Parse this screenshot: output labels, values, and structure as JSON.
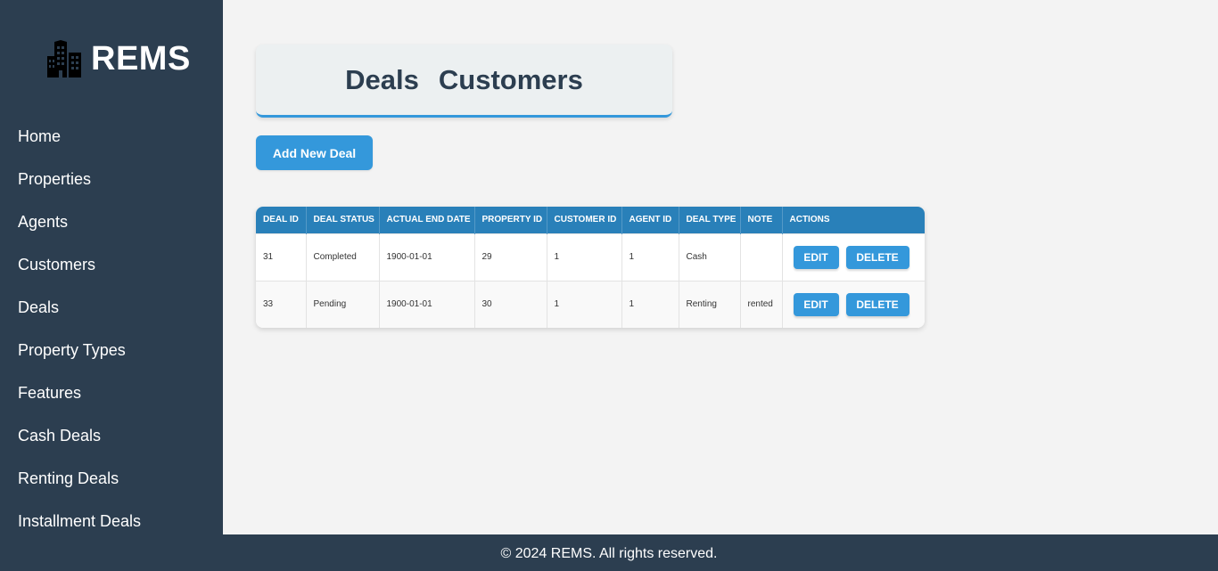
{
  "sidebar": {
    "brand": "REMS",
    "logo_icon": "buildings-icon",
    "items": [
      {
        "label": "Home"
      },
      {
        "label": "Properties"
      },
      {
        "label": "Agents"
      },
      {
        "label": "Customers"
      },
      {
        "label": "Deals"
      },
      {
        "label": "Property Types"
      },
      {
        "label": "Features"
      },
      {
        "label": "Cash Deals"
      },
      {
        "label": "Renting Deals"
      },
      {
        "label": "Installment Deals"
      }
    ]
  },
  "header": {
    "tab_deals": "Deals",
    "tab_customers": "Customers"
  },
  "toolbar": {
    "add_label": "Add New Deal"
  },
  "table": {
    "columns": [
      "DEAL ID",
      "DEAL STATUS",
      "ACTUAL END DATE",
      "PROPERTY ID",
      "CUSTOMER ID",
      "AGENT ID",
      "DEAL TYPE",
      "NOTE",
      "ACTIONS"
    ],
    "rows": [
      {
        "deal_id": "31",
        "status": "Completed",
        "end_date": "1900-01-01",
        "property_id": "29",
        "customer_id": "1",
        "agent_id": "1",
        "type": "Cash",
        "note": ""
      },
      {
        "deal_id": "33",
        "status": "Pending",
        "end_date": "1900-01-01",
        "property_id": "30",
        "customer_id": "1",
        "agent_id": "1",
        "type": "Renting",
        "note": "rented"
      }
    ],
    "edit_label": "EDIT",
    "delete_label": "DELETE"
  },
  "footer": {
    "text": "© 2024 REMS. All rights reserved."
  },
  "colors": {
    "sidebar_bg": "#2c3e50",
    "accent": "#3498db",
    "table_header": "#2980b9",
    "page_bg": "#f3f3f3"
  }
}
